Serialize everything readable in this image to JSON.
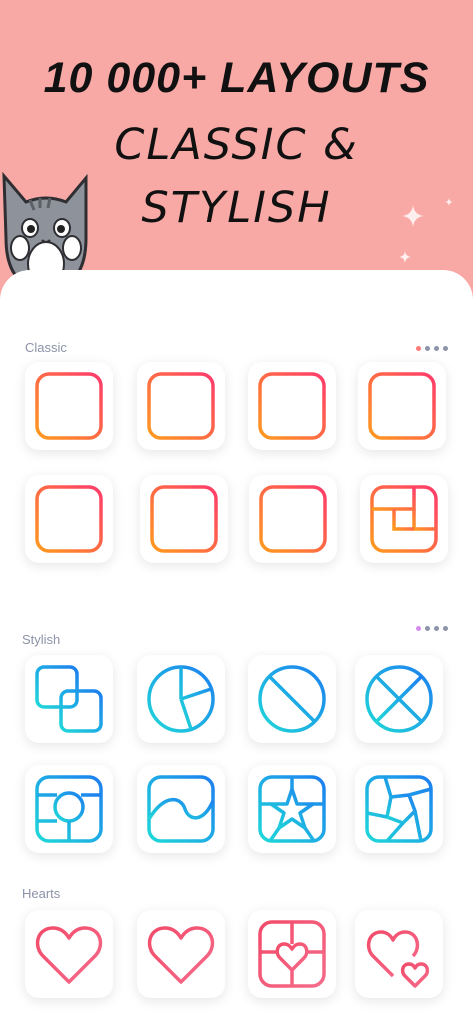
{
  "hero": {
    "headline": "10 000+ LAYOUTS",
    "subline_1": "CLASSIC &",
    "subline_2": "STYLISH"
  },
  "sections": {
    "classic": {
      "title": "Classic",
      "dot_active": "#ff7a7a"
    },
    "stylish": {
      "title": "Stylish",
      "dot_active": "#d68af0"
    },
    "hearts": {
      "title": "Hearts"
    }
  },
  "colors": {
    "hero_bg": "#f8a9a5",
    "classic_gradient": [
      "#ff9a1f",
      "#ff3b6b"
    ],
    "stylish_gradient": [
      "#1fd8d8",
      "#1d7ff0"
    ],
    "hearts_color": "#f24b6a"
  },
  "icons": {
    "classic": [
      "layout-single-icon",
      "layout-two-vertical-icon",
      "layout-two-horizontal-icon",
      "layout-three-vertical-icon",
      "layout-grid-t-icon",
      "layout-grid-four-icon",
      "layout-grid-mixed-icon",
      "layout-pinwheel-icon"
    ],
    "stylish": [
      "overlap-squares-icon",
      "circle-pie-icon",
      "circle-diagonal-icon",
      "circle-x-icon",
      "frame-circle-icon",
      "frame-wave-icon",
      "frame-star-icon",
      "frame-aperture-icon"
    ],
    "hearts": [
      "heart-icon",
      "heart-split-icon",
      "frame-heart-icon",
      "double-heart-icon"
    ]
  }
}
